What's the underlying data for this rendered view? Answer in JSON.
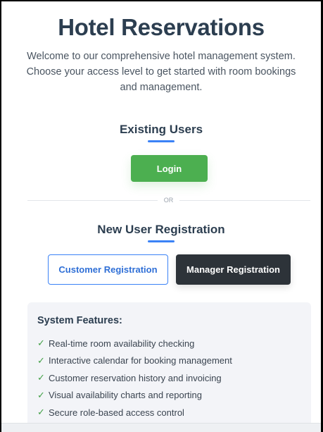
{
  "page": {
    "title": "Hotel Reservations",
    "subtitle": "Welcome to our comprehensive hotel management system. Choose your access level to get started with room bookings and management."
  },
  "existing_users": {
    "heading": "Existing Users",
    "login_label": "Login"
  },
  "divider": {
    "text": "OR"
  },
  "new_users": {
    "heading": "New User Registration",
    "customer_label": "Customer Registration",
    "manager_label": "Manager Registration"
  },
  "features": {
    "title": "System Features:",
    "check_glyph": "✓",
    "items": [
      "Real-time room availability checking",
      "Interactive calendar for booking management",
      "Customer reservation history and invoicing",
      "Visual availability charts and reporting",
      "Secure role-based access control"
    ]
  },
  "colors": {
    "login": "#4caf50",
    "manager": "#2d3339",
    "accent": "#3b82f6",
    "check": "#43a047"
  }
}
